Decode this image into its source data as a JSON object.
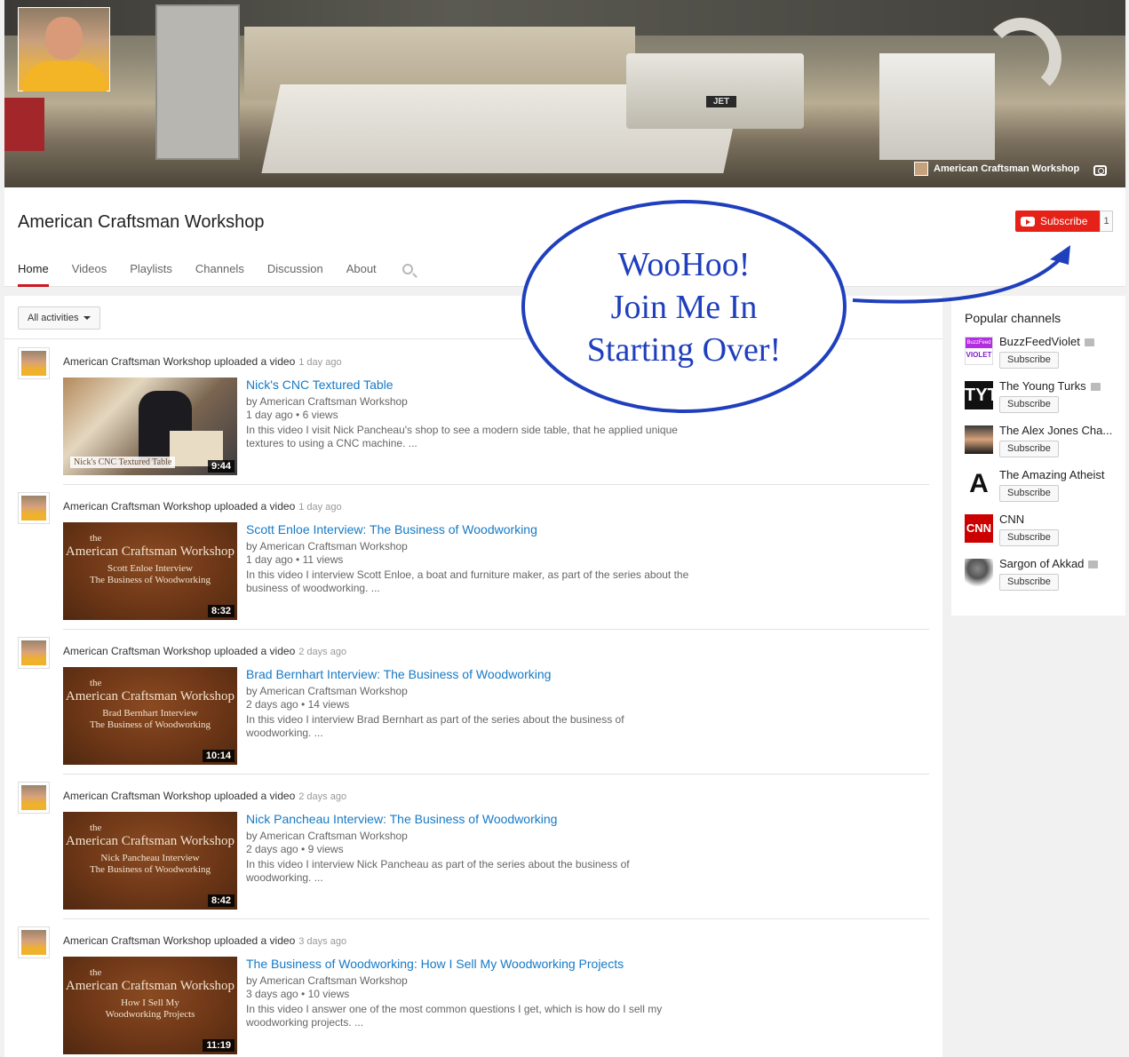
{
  "banner": {
    "channel_link": "American Craftsman Workshop",
    "machine_label": "JET"
  },
  "channel": {
    "title": "American Craftsman Workshop",
    "subscribe_label": "Subscribe",
    "subscriber_count": "1"
  },
  "tabs": [
    {
      "label": "Home",
      "active": true
    },
    {
      "label": "Videos"
    },
    {
      "label": "Playlists"
    },
    {
      "label": "Channels"
    },
    {
      "label": "Discussion"
    },
    {
      "label": "About"
    }
  ],
  "feed": {
    "filter_label": "All activities",
    "items": [
      {
        "actor": "American Craftsman Workshop uploaded a video",
        "ago": "1 day ago",
        "title": "Nick's CNC Textured Table",
        "by": "by American Craftsman Workshop",
        "stats": "1 day ago • 6 views",
        "desc": "In this video I visit Nick Pancheau's shop to see a modern side table, that he applied unique textures to using a CNC machine. ...",
        "duration": "9:44",
        "thumb_caption": "Nick's CNC Textured Table"
      },
      {
        "actor": "American Craftsman Workshop uploaded a video",
        "ago": "1 day ago",
        "title": "Scott Enloe Interview: The Business of Woodworking",
        "by": "by American Craftsman Workshop",
        "stats": "1 day ago • 11 views",
        "desc": "In this video I interview Scott Enloe, a boat and furniture maker, as part of the series about the business of woodworking. ...",
        "duration": "8:32",
        "thumb_the": "the",
        "thumb_brand": "American Craftsman Workshop",
        "thumb_line1": "Scott Enloe Interview",
        "thumb_line2": "The Business of Woodworking"
      },
      {
        "actor": "American Craftsman Workshop uploaded a video",
        "ago": "2 days ago",
        "title": "Brad Bernhart Interview: The Business of Woodworking",
        "by": "by American Craftsman Workshop",
        "stats": "2 days ago • 14 views",
        "desc": "In this video I interview Brad Bernhart as part of the series about the business of woodworking. ...",
        "duration": "10:14",
        "thumb_the": "the",
        "thumb_brand": "American Craftsman Workshop",
        "thumb_line1": "Brad Bernhart Interview",
        "thumb_line2": "The Business of Woodworking"
      },
      {
        "actor": "American Craftsman Workshop uploaded a video",
        "ago": "2 days ago",
        "title": "Nick Pancheau Interview: The Business of Woodworking",
        "by": "by American Craftsman Workshop",
        "stats": "2 days ago • 9 views",
        "desc": "In this video I interview Nick Pancheau as part of the series about the business of woodworking. ...",
        "duration": "8:42",
        "thumb_the": "the",
        "thumb_brand": "American Craftsman Workshop",
        "thumb_line1": "Nick Pancheau Interview",
        "thumb_line2": "The Business of Woodworking"
      },
      {
        "actor": "American Craftsman Workshop uploaded a video",
        "ago": "3 days ago",
        "title": "The Business of Woodworking: How I Sell My Woodworking Projects",
        "by": "by American Craftsman Workshop",
        "stats": "3 days ago • 10 views",
        "desc": "In this video I answer one of the most common questions I get, which is how do I sell my woodworking projects. ...",
        "duration": "11:19",
        "thumb_the": "the",
        "thumb_brand": "American Craftsman Workshop",
        "thumb_line1": "How I Sell My",
        "thumb_line2": "Woodworking Projects"
      }
    ]
  },
  "popular": {
    "heading": "Popular channels",
    "subscribe_label": "Subscribe",
    "channels": [
      {
        "name": "BuzzFeedViolet",
        "verified": true,
        "logo_top": "BuzzFeed",
        "logo_bottom": "VIOLET"
      },
      {
        "name": "The Young Turks",
        "verified": true,
        "logo_text": "TYT"
      },
      {
        "name": "The Alex Jones Cha...",
        "verified": false
      },
      {
        "name": "The Amazing Atheist",
        "verified": false,
        "logo_text": "A"
      },
      {
        "name": "CNN",
        "verified": false,
        "logo_text": "CNN"
      },
      {
        "name": "Sargon of Akkad",
        "verified": true
      }
    ]
  },
  "callout": {
    "line1": "WooHoo!",
    "line2": "Join Me In",
    "line3": "Starting Over!",
    "color": "#1f3fbd"
  }
}
